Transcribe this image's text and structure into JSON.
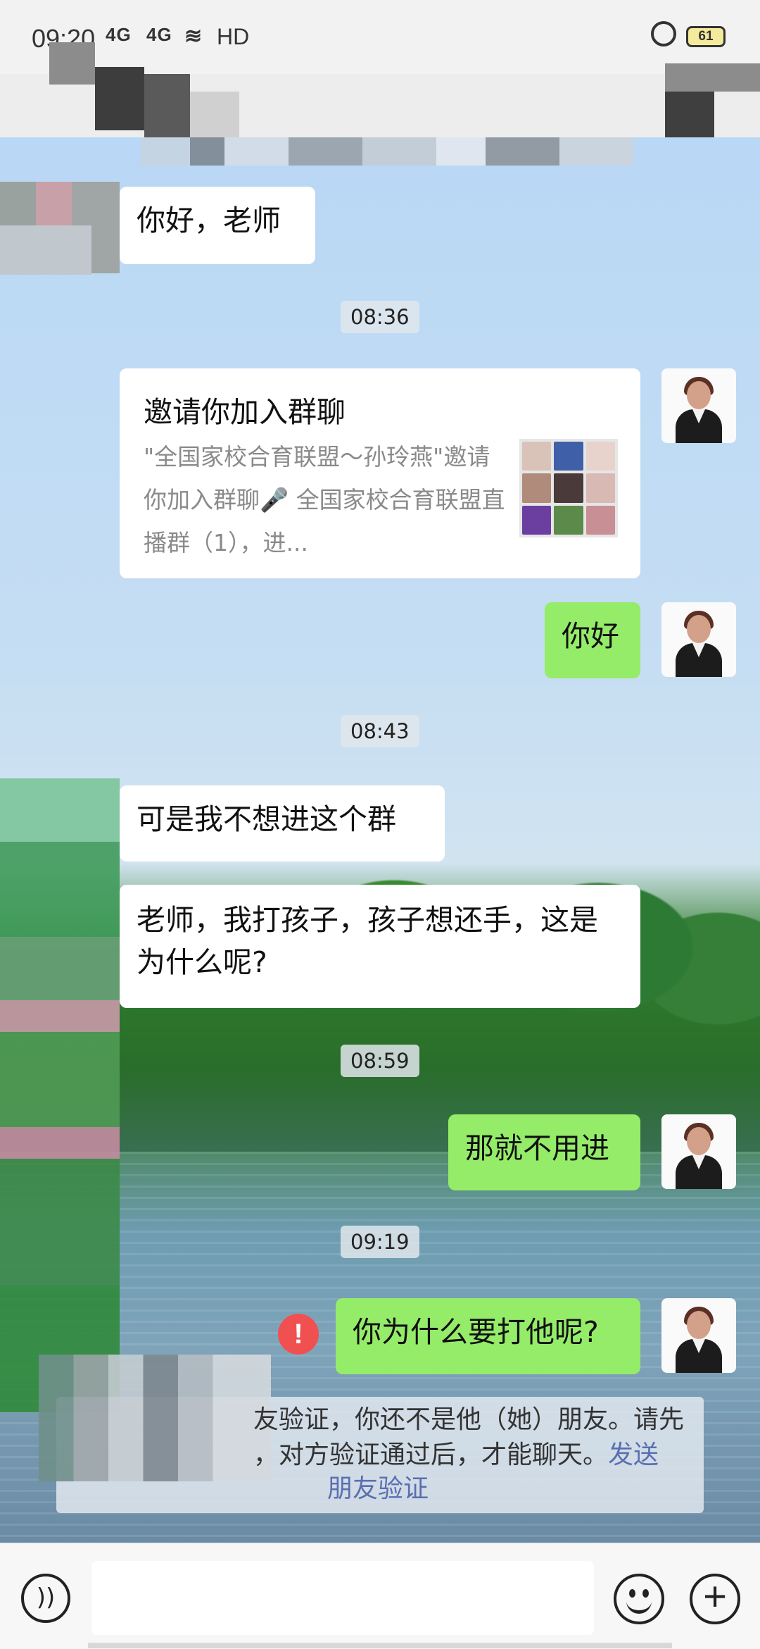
{
  "status_bar": {
    "time": "09:20",
    "signal_1": "4G",
    "signal_2": "4G",
    "hd": "HD",
    "battery": "61"
  },
  "messages": [
    {
      "side": "left",
      "text": "你好，老师"
    },
    {
      "timestamp": "08:36"
    },
    {
      "side": "right",
      "type": "group_invite_card",
      "title": "邀请你加入群聊",
      "description": "\"全国家校合育联盟～孙玲燕\"邀请你加入群聊🎤 全国家校合育联盟直播群（1），进..."
    },
    {
      "side": "right",
      "text": "你好"
    },
    {
      "timestamp": "08:43"
    },
    {
      "side": "left",
      "text": "可是我不想进这个群"
    },
    {
      "side": "left",
      "text": "老师，我打孩子，孩子想还手，这是为什么呢?"
    },
    {
      "timestamp": "08:59"
    },
    {
      "side": "right",
      "text": "那就不用进"
    },
    {
      "timestamp": "09:19"
    },
    {
      "side": "right",
      "text": "你为什么要打他呢?",
      "error": "!"
    }
  ],
  "system_notice": {
    "line_1": "友验证，你还不是他（她）朋友。请先",
    "line_2": "，对方验证通过后，才能聊天。",
    "link_part_1": "发送",
    "link_part_2": "朋友验证"
  },
  "bottom_bar": {
    "voice_icon": "voice-icon",
    "emoji_icon": "emoji-icon",
    "plus_icon": "plus-icon"
  },
  "colors": {
    "sent_bubble": "#95ec69",
    "received_bubble": "#ffffff",
    "error": "#f05050",
    "link": "#5a6fb0"
  }
}
